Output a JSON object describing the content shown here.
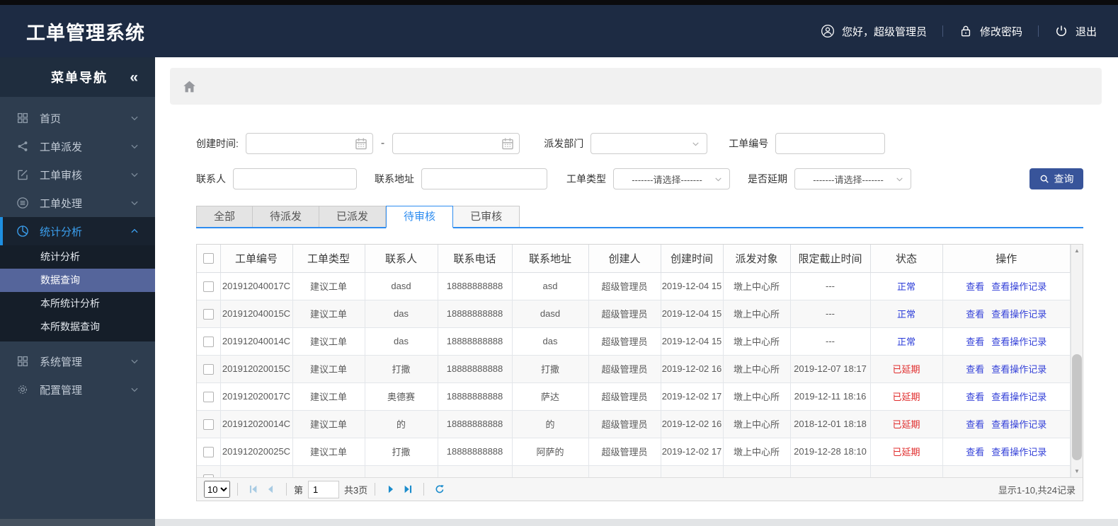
{
  "header": {
    "title": "工单管理系统",
    "greeting": "您好，超级管理员",
    "change_password": "修改密码",
    "logout": "退出"
  },
  "sidebar": {
    "title": "菜单导航",
    "collapse_icon": "«",
    "items": [
      {
        "label": "首页",
        "icon": "grid-icon"
      },
      {
        "label": "工单派发",
        "icon": "share-icon"
      },
      {
        "label": "工单审核",
        "icon": "edit-icon"
      },
      {
        "label": "工单处理",
        "icon": "process-icon"
      },
      {
        "label": "统计分析",
        "icon": "pie-chart-icon",
        "expanded": true,
        "children": [
          {
            "label": "统计分析"
          },
          {
            "label": "数据查询",
            "selected": true
          },
          {
            "label": "本所统计分析"
          },
          {
            "label": "本所数据查询"
          }
        ]
      },
      {
        "label": "系统管理",
        "icon": "grid-icon"
      },
      {
        "label": "配置管理",
        "icon": "gear-icon"
      }
    ]
  },
  "breadcrumb": {
    "icon": "home-icon"
  },
  "filters": {
    "created_label": "创建时间:",
    "range_separator": "-",
    "dept_label": "派发部门",
    "order_label": "工单编号",
    "contact_label": "联系人",
    "address_label": "联系地址",
    "type_label": "工单类型",
    "type_value": "-------请选择-------",
    "delay_label": "是否延期",
    "delay_value": "-------请选择-------",
    "search_label": "查询",
    "date_icon": "calendar-icon",
    "select_icon": "chevron-down-icon",
    "search_icon": "search-icon"
  },
  "tabs": {
    "items": [
      {
        "label": "全部"
      },
      {
        "label": "待派发"
      },
      {
        "label": "已派发"
      },
      {
        "label": "待审核",
        "active": true
      },
      {
        "label": "已审核"
      }
    ]
  },
  "table": {
    "columns": [
      "工单编号",
      "工单类型",
      "联系人",
      "联系电话",
      "联系地址",
      "创建人",
      "创建时间",
      "派发对象",
      "限定截止时间",
      "状态",
      "操作"
    ],
    "action_view": "查看",
    "action_view_log": "查看操作记录",
    "rows": [
      {
        "id": "201912040017C",
        "type": "建议工单",
        "contact": "dasd",
        "phone": "18888888888",
        "address": "asd",
        "creator": "超级管理员",
        "created": "2019-12-04 15",
        "target": "墩上中心所",
        "deadline": "---",
        "status": "正常",
        "delayed": false
      },
      {
        "id": "201912040015C",
        "type": "建议工单",
        "contact": "das",
        "phone": "18888888888",
        "address": "dasd",
        "creator": "超级管理员",
        "created": "2019-12-04 15",
        "target": "墩上中心所",
        "deadline": "---",
        "status": "正常",
        "delayed": false
      },
      {
        "id": "201912040014C",
        "type": "建议工单",
        "contact": "das",
        "phone": "18888888888",
        "address": "das",
        "creator": "超级管理员",
        "created": "2019-12-04 15",
        "target": "墩上中心所",
        "deadline": "---",
        "status": "正常",
        "delayed": false
      },
      {
        "id": "201912020015C",
        "type": "建议工单",
        "contact": "打撒",
        "phone": "18888888888",
        "address": "打撒",
        "creator": "超级管理员",
        "created": "2019-12-02 16",
        "target": "墩上中心所",
        "deadline": "2019-12-07 18:17",
        "status": "已延期",
        "delayed": true
      },
      {
        "id": "201912020017C",
        "type": "建议工单",
        "contact": "奥德赛",
        "phone": "18888888888",
        "address": "萨达",
        "creator": "超级管理员",
        "created": "2019-12-02 17",
        "target": "墩上中心所",
        "deadline": "2019-12-11 18:16",
        "status": "已延期",
        "delayed": true
      },
      {
        "id": "201912020014C",
        "type": "建议工单",
        "contact": "的",
        "phone": "18888888888",
        "address": "的",
        "creator": "超级管理员",
        "created": "2019-12-02 16",
        "target": "墩上中心所",
        "deadline": "2018-12-01 18:18",
        "status": "已延期",
        "delayed": true
      },
      {
        "id": "201912020025C",
        "type": "建议工单",
        "contact": "打撒",
        "phone": "18888888888",
        "address": "阿萨的",
        "creator": "超级管理员",
        "created": "2019-12-02 17",
        "target": "墩上中心所",
        "deadline": "2019-12-28 18:10",
        "status": "已延期",
        "delayed": true
      }
    ]
  },
  "pager": {
    "page_size": "10",
    "page_prefix": "第",
    "current_page": "1",
    "total_pages": "共3页",
    "summary": "显示1-10,共24记录",
    "icons": [
      "first-page-icon",
      "prev-page-icon",
      "next-page-icon",
      "last-page-icon",
      "refresh-icon"
    ]
  },
  "colors": {
    "topbar_bg": "#1d2b43",
    "sidebar_bg": "#2e3d4f",
    "accent": "#2d8cf0",
    "primary_button": "#38549a",
    "submenu_selected_bg": "#55659b",
    "link": "#3340d8",
    "status_normal": "#2a3bd8",
    "status_delayed": "#e02b2b"
  }
}
